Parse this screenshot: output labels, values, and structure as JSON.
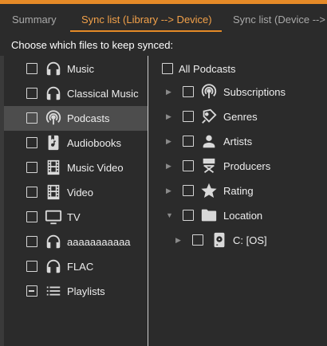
{
  "colors": {
    "accent": "#e58a27",
    "tab_active": "#f2a14a",
    "background": "#2b2b2b",
    "selected_row": "#4d4d4d"
  },
  "tabs": [
    {
      "label": "Summary",
      "active": false
    },
    {
      "label": "Sync list (Library --> Device)",
      "active": true
    },
    {
      "label": "Sync list (Device --> L",
      "active": false
    }
  ],
  "instruction": "Choose which files to keep synced:",
  "left_items": [
    {
      "label": "Music",
      "icon": "headphones-icon",
      "selected": false
    },
    {
      "label": "Classical Music",
      "icon": "headphones-icon",
      "selected": false
    },
    {
      "label": "Podcasts",
      "icon": "podcast-icon",
      "selected": true
    },
    {
      "label": "Audiobooks",
      "icon": "audiobook-icon",
      "selected": false
    },
    {
      "label": "Music Video",
      "icon": "film-icon",
      "selected": false
    },
    {
      "label": "Video",
      "icon": "film-icon",
      "selected": false
    },
    {
      "label": "TV",
      "icon": "tv-icon",
      "selected": false
    },
    {
      "label": "aaaaaaaaaaa",
      "icon": "headphones-icon",
      "selected": false
    },
    {
      "label": "FLAC",
      "icon": "headphones-icon",
      "selected": false
    },
    {
      "label": "Playlists",
      "icon": "playlist-icon",
      "selected": false,
      "checkbox": "partial"
    }
  ],
  "right_items": [
    {
      "label": "All Podcasts",
      "icon": "",
      "expander": "none"
    },
    {
      "label": "Subscriptions",
      "icon": "podcast-icon",
      "expander": "collapsed"
    },
    {
      "label": "Genres",
      "icon": "tag-icon",
      "expander": "collapsed"
    },
    {
      "label": "Artists",
      "icon": "person-icon",
      "expander": "collapsed"
    },
    {
      "label": "Producers",
      "icon": "director-chair-icon",
      "expander": "collapsed"
    },
    {
      "label": "Rating",
      "icon": "star-icon",
      "expander": "collapsed"
    },
    {
      "label": "Location",
      "icon": "folder-icon",
      "expander": "expanded"
    },
    {
      "label": "C: [OS]",
      "icon": "drive-icon",
      "expander": "collapsed"
    }
  ]
}
